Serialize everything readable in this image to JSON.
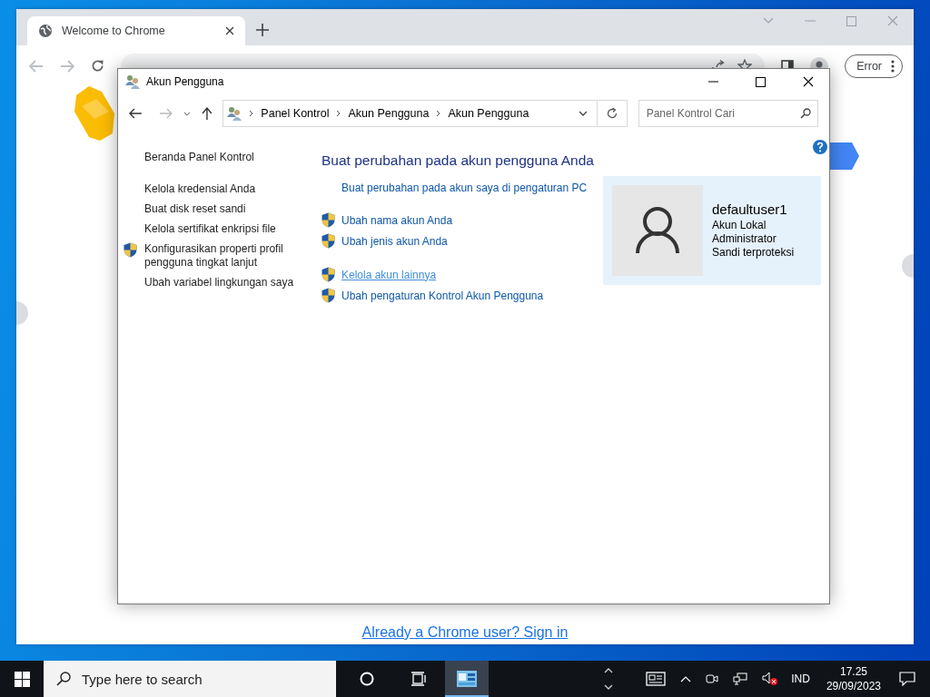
{
  "chrome": {
    "tabs": [
      {
        "title": "Welcome to Chrome",
        "selected": true
      }
    ],
    "profile_button": "Error",
    "signin_link": "Already a Chrome user? Sign in"
  },
  "dialog": {
    "title": "Akun Pengguna",
    "breadcrumb": [
      "Panel Kontrol",
      "Akun Pengguna",
      "Akun Pengguna"
    ],
    "search": {
      "placeholder": "Panel Kontrol Cari"
    },
    "sidebar": {
      "home": "Beranda Panel Kontrol",
      "items": [
        {
          "label": "Kelola kredensial Anda",
          "shield": false
        },
        {
          "label": "Buat disk reset sandi",
          "shield": false
        },
        {
          "label": "Kelola sertifikat enkripsi file",
          "shield": false
        },
        {
          "label": "Konfigurasikan properti profil pengguna tingkat lanjut",
          "shield": true
        },
        {
          "label": "Ubah variabel lingkungan saya",
          "shield": false
        }
      ]
    },
    "heading": "Buat perubahan pada akun pengguna Anda",
    "task_groups": [
      {
        "links": [
          {
            "label": "Buat perubahan pada akun saya di pengaturan PC",
            "shield": false,
            "hovered": false
          }
        ]
      },
      {
        "links": [
          {
            "label": "Ubah nama akun Anda",
            "shield": true,
            "hovered": false
          },
          {
            "label": "Ubah jenis akun Anda",
            "shield": true,
            "hovered": false
          }
        ]
      },
      {
        "links": [
          {
            "label": "Kelola akun lainnya",
            "shield": true,
            "hovered": true
          },
          {
            "label": "Ubah pengaturan Kontrol Akun Pengguna",
            "shield": true,
            "hovered": false
          }
        ]
      }
    ],
    "account": {
      "name": "defaultuser1",
      "details": [
        "Akun Lokal",
        "Administrator",
        "Sandi terproteksi"
      ]
    }
  },
  "taskbar": {
    "search": {
      "placeholder": "Type here to search"
    },
    "apps": [
      {
        "kind": "control-panel",
        "selected": true
      }
    ],
    "language": "IND",
    "time": "17.25",
    "date": "29/09/2023"
  }
}
